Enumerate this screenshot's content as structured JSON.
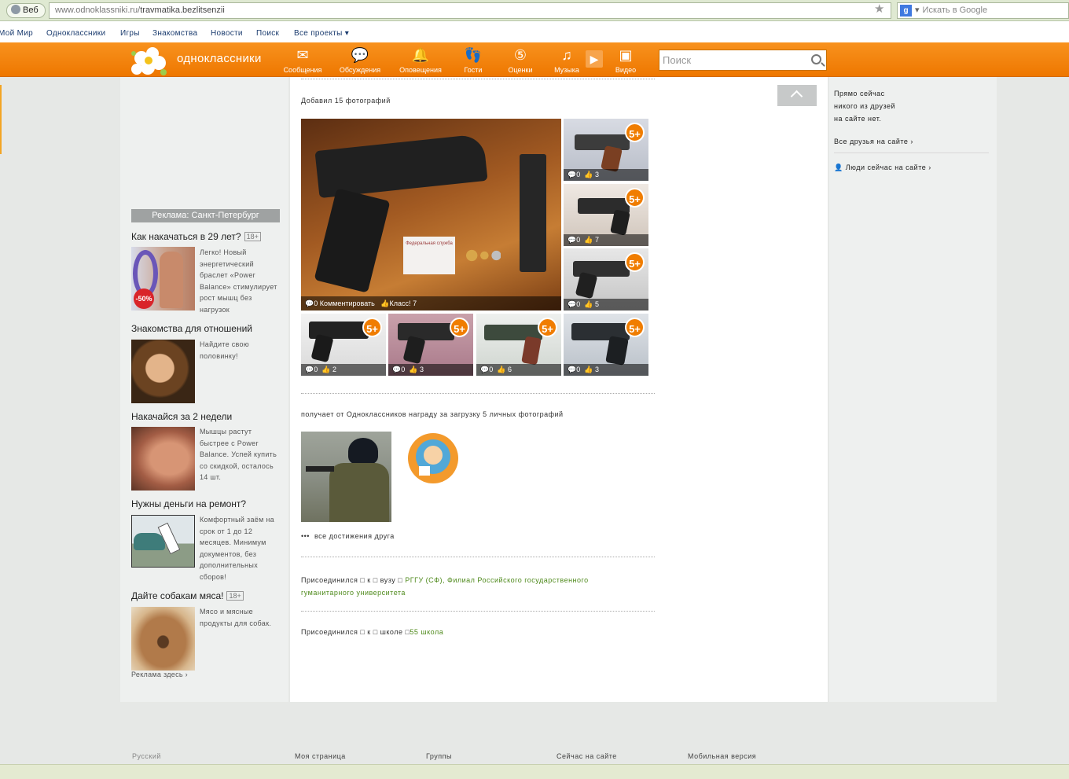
{
  "browser": {
    "tab_label": "Веб",
    "url_host": "www.odnoklassniki.ru/",
    "url_path": "travmatika.bezlitsenzii",
    "search_placeholder": "Искать в Google"
  },
  "top_nav": {
    "items": [
      "Мой Мир",
      "Одноклассники",
      "Игры",
      "Знакомства",
      "Новости",
      "Поиск",
      "Все проекты ▾"
    ]
  },
  "header": {
    "brand": "одноклассники",
    "nav": [
      "Сообщения",
      "Обсуждения",
      "Оповещения",
      "Гости",
      "Оценки",
      "Музыка",
      "Видео"
    ],
    "search_placeholder": "Поиск"
  },
  "ads": {
    "header": "Реклама: Санкт-Петербург",
    "items": [
      {
        "title": "Как накачаться в 29 лет?",
        "age": "18+",
        "text": "Легко! Новый энергетический браслет «Power Balance» стимулирует рост мышц без нагрузок"
      },
      {
        "title": "Знакомства для отношений",
        "age": "",
        "text": "Найдите свою половинку!"
      },
      {
        "title": "Накачайся за 2 недели",
        "age": "",
        "text": "Мышцы растут быстрее с Power Balance. Успей купить со скидкой, осталось 14 шт."
      },
      {
        "title": "Нужны деньги на ремонт?",
        "age": "",
        "text": "Комфортный заём на срок от 1 до 12 месяцев. Минимум документов, без дополнительных сборов!"
      },
      {
        "title": "Дайте собакам мяса!",
        "age": "18+",
        "text": "Мясо и мясные продукты для собак."
      }
    ],
    "more": "Реклама здесь ›",
    "discount": "-50%"
  },
  "feed": {
    "added_photos": "Добавил 15 фотографий",
    "main_photo": {
      "comments": "0",
      "comment_label": "Комментировать",
      "class_label": "Класс!",
      "class_count": "7",
      "doc_text": "Федеральная служба"
    },
    "badge": "5+",
    "side_photos": [
      {
        "comments": "0",
        "likes": "3"
      },
      {
        "comments": "0",
        "likes": "7"
      },
      {
        "comments": "0",
        "likes": "5"
      }
    ],
    "bottom_photos": [
      {
        "comments": "0",
        "likes": "2"
      },
      {
        "comments": "0",
        "likes": "3"
      },
      {
        "comments": "0",
        "likes": "6"
      },
      {
        "comments": "0",
        "likes": "3"
      }
    ],
    "award_text": "получает от Одноклассников награду за загрузку 5 личных фотографий",
    "all_achievements": "все достижения друга",
    "joined_uni_prefix": "Присоединился □ к □ вузу □",
    "uni_link": "РГГУ (СФ), Филиал Российского государственного гуманитарного университета",
    "joined_school_prefix": "Присоединился □ к □ школе □",
    "school_link": "55 школа"
  },
  "right": {
    "online_text": [
      "Прямо сейчас",
      "никого из друзей",
      "на сайте нет."
    ],
    "all_friends": "Все друзья на сайте ›",
    "people_online": "Люди сейчас на сайте ›"
  },
  "footer": {
    "items": [
      "Русский",
      "Моя страница",
      "Группы",
      "Сейчас на сайте",
      "Мобильная версия"
    ]
  }
}
